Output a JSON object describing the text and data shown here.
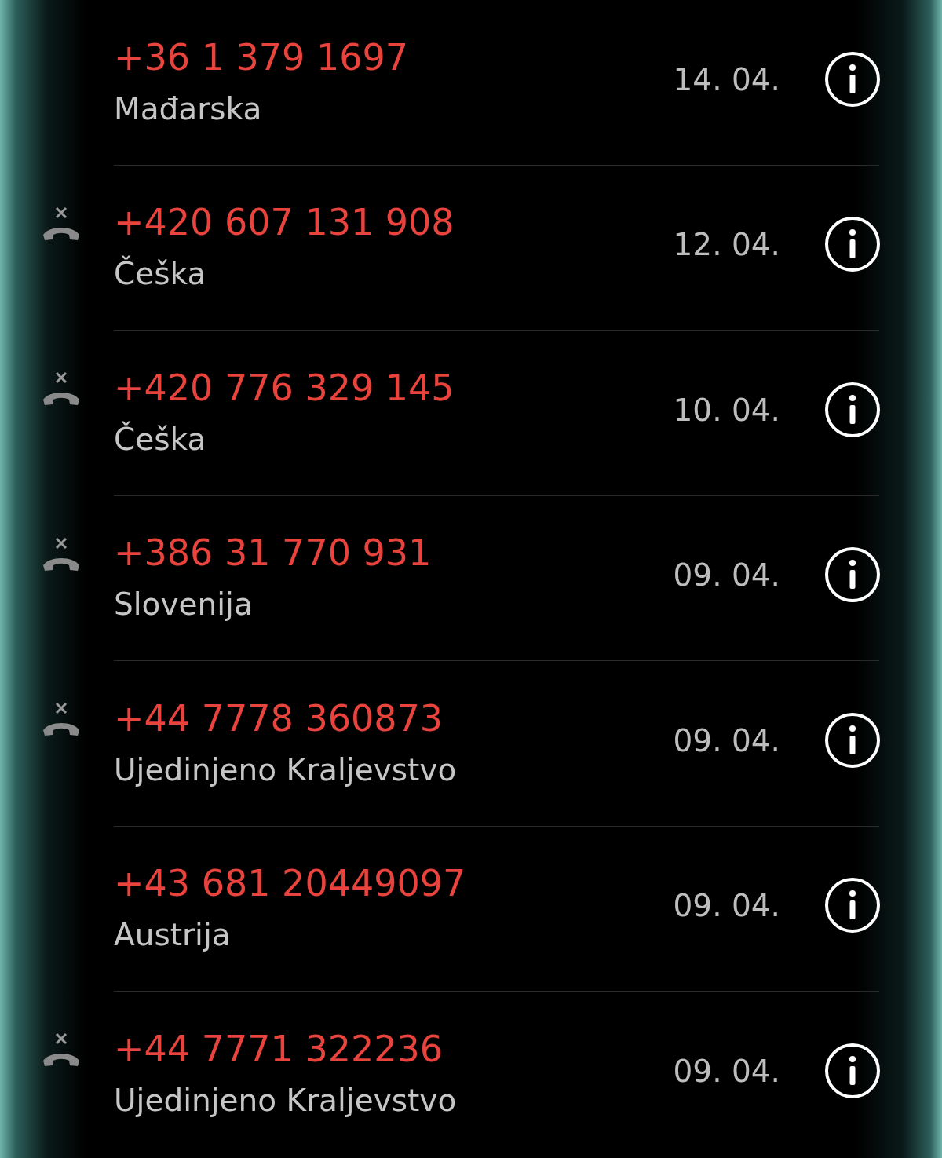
{
  "calls": [
    {
      "number": "+36 1 379 1697",
      "location": "Mađarska",
      "date": "14. 04.",
      "rejected": false
    },
    {
      "number": "+420 607 131 908",
      "location": "Češka",
      "date": "12. 04.",
      "rejected": true
    },
    {
      "number": "+420 776 329 145",
      "location": "Češka",
      "date": "10. 04.",
      "rejected": true
    },
    {
      "number": "+386 31 770 931",
      "location": "Slovenija",
      "date": "09. 04.",
      "rejected": true
    },
    {
      "number": "+44 7778 360873",
      "location": "Ujedinjeno Kraljevstvo",
      "date": "09. 04.",
      "rejected": true
    },
    {
      "number": "+43 681 20449097",
      "location": "Austrija",
      "date": "09. 04.",
      "rejected": false
    },
    {
      "number": "+44 7771 322236",
      "location": "Ujedinjeno Kraljevstvo",
      "date": "09. 04.",
      "rejected": true
    }
  ]
}
